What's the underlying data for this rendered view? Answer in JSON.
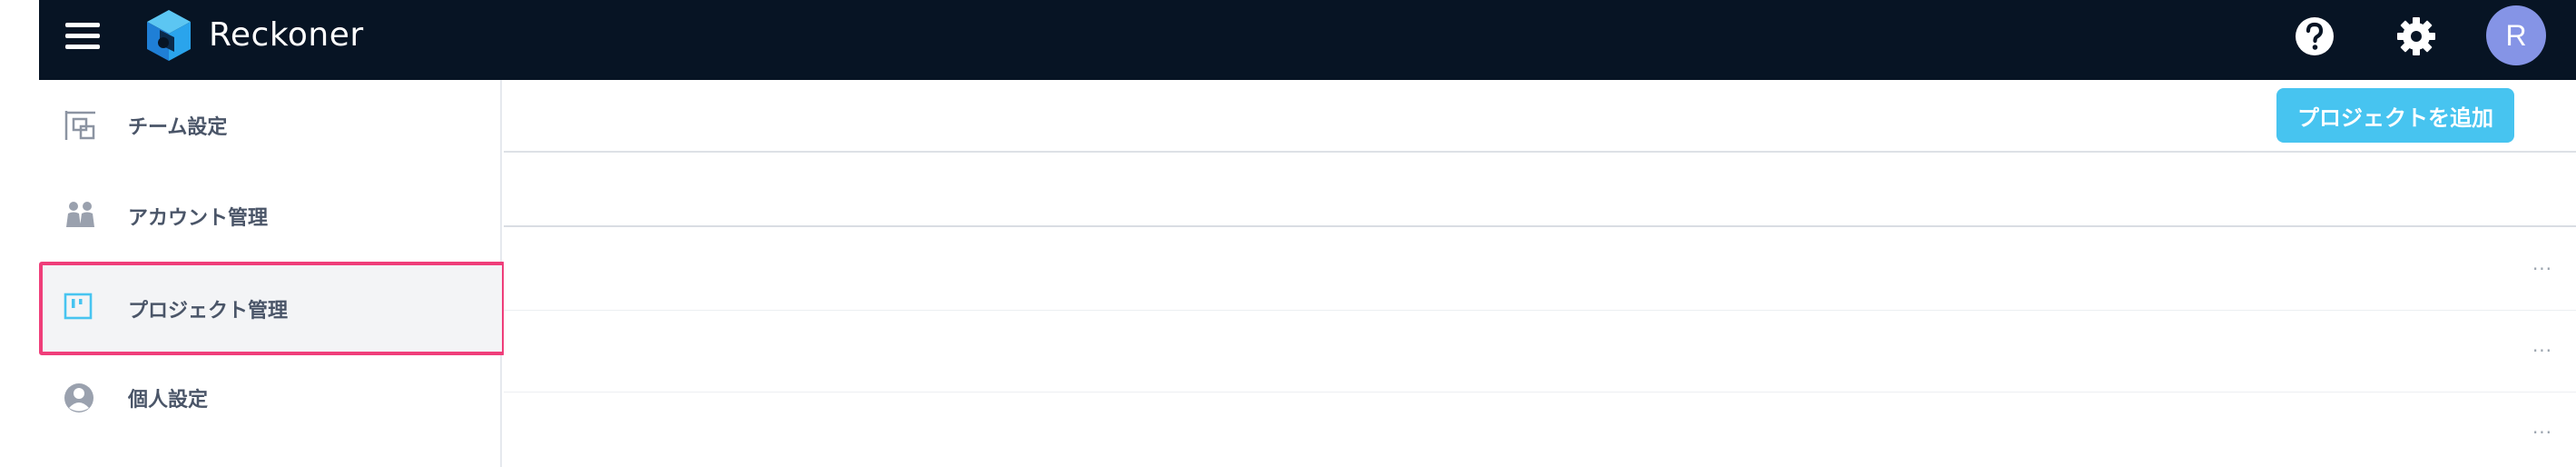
{
  "app": {
    "brand": "Reckoner",
    "avatar_initial": "R"
  },
  "icons": {
    "menu": "hamburger-menu-icon",
    "logo": "reckoner-logo",
    "help": "help-icon",
    "settings": "gear-icon"
  },
  "sidebar": {
    "items": [
      {
        "label": "チーム設定",
        "icon": "team-settings-icon"
      },
      {
        "label": "アカウント管理",
        "icon": "accounts-icon"
      },
      {
        "label": "プロジェクト管理",
        "icon": "project-board-icon",
        "selected": true
      },
      {
        "label": "個人設定",
        "icon": "user-circle-icon"
      }
    ]
  },
  "main": {
    "add_project_label": "プロジェクトを追加",
    "rows": [
      {
        "more": "···"
      },
      {
        "more": "···"
      },
      {
        "more": "···"
      }
    ]
  },
  "colors": {
    "topbar": "#071424",
    "accent_button": "#47c4f0",
    "selection_outline": "#ef3e7a",
    "avatar": "#8594e6",
    "selected_bg": "#f3f4f6"
  }
}
